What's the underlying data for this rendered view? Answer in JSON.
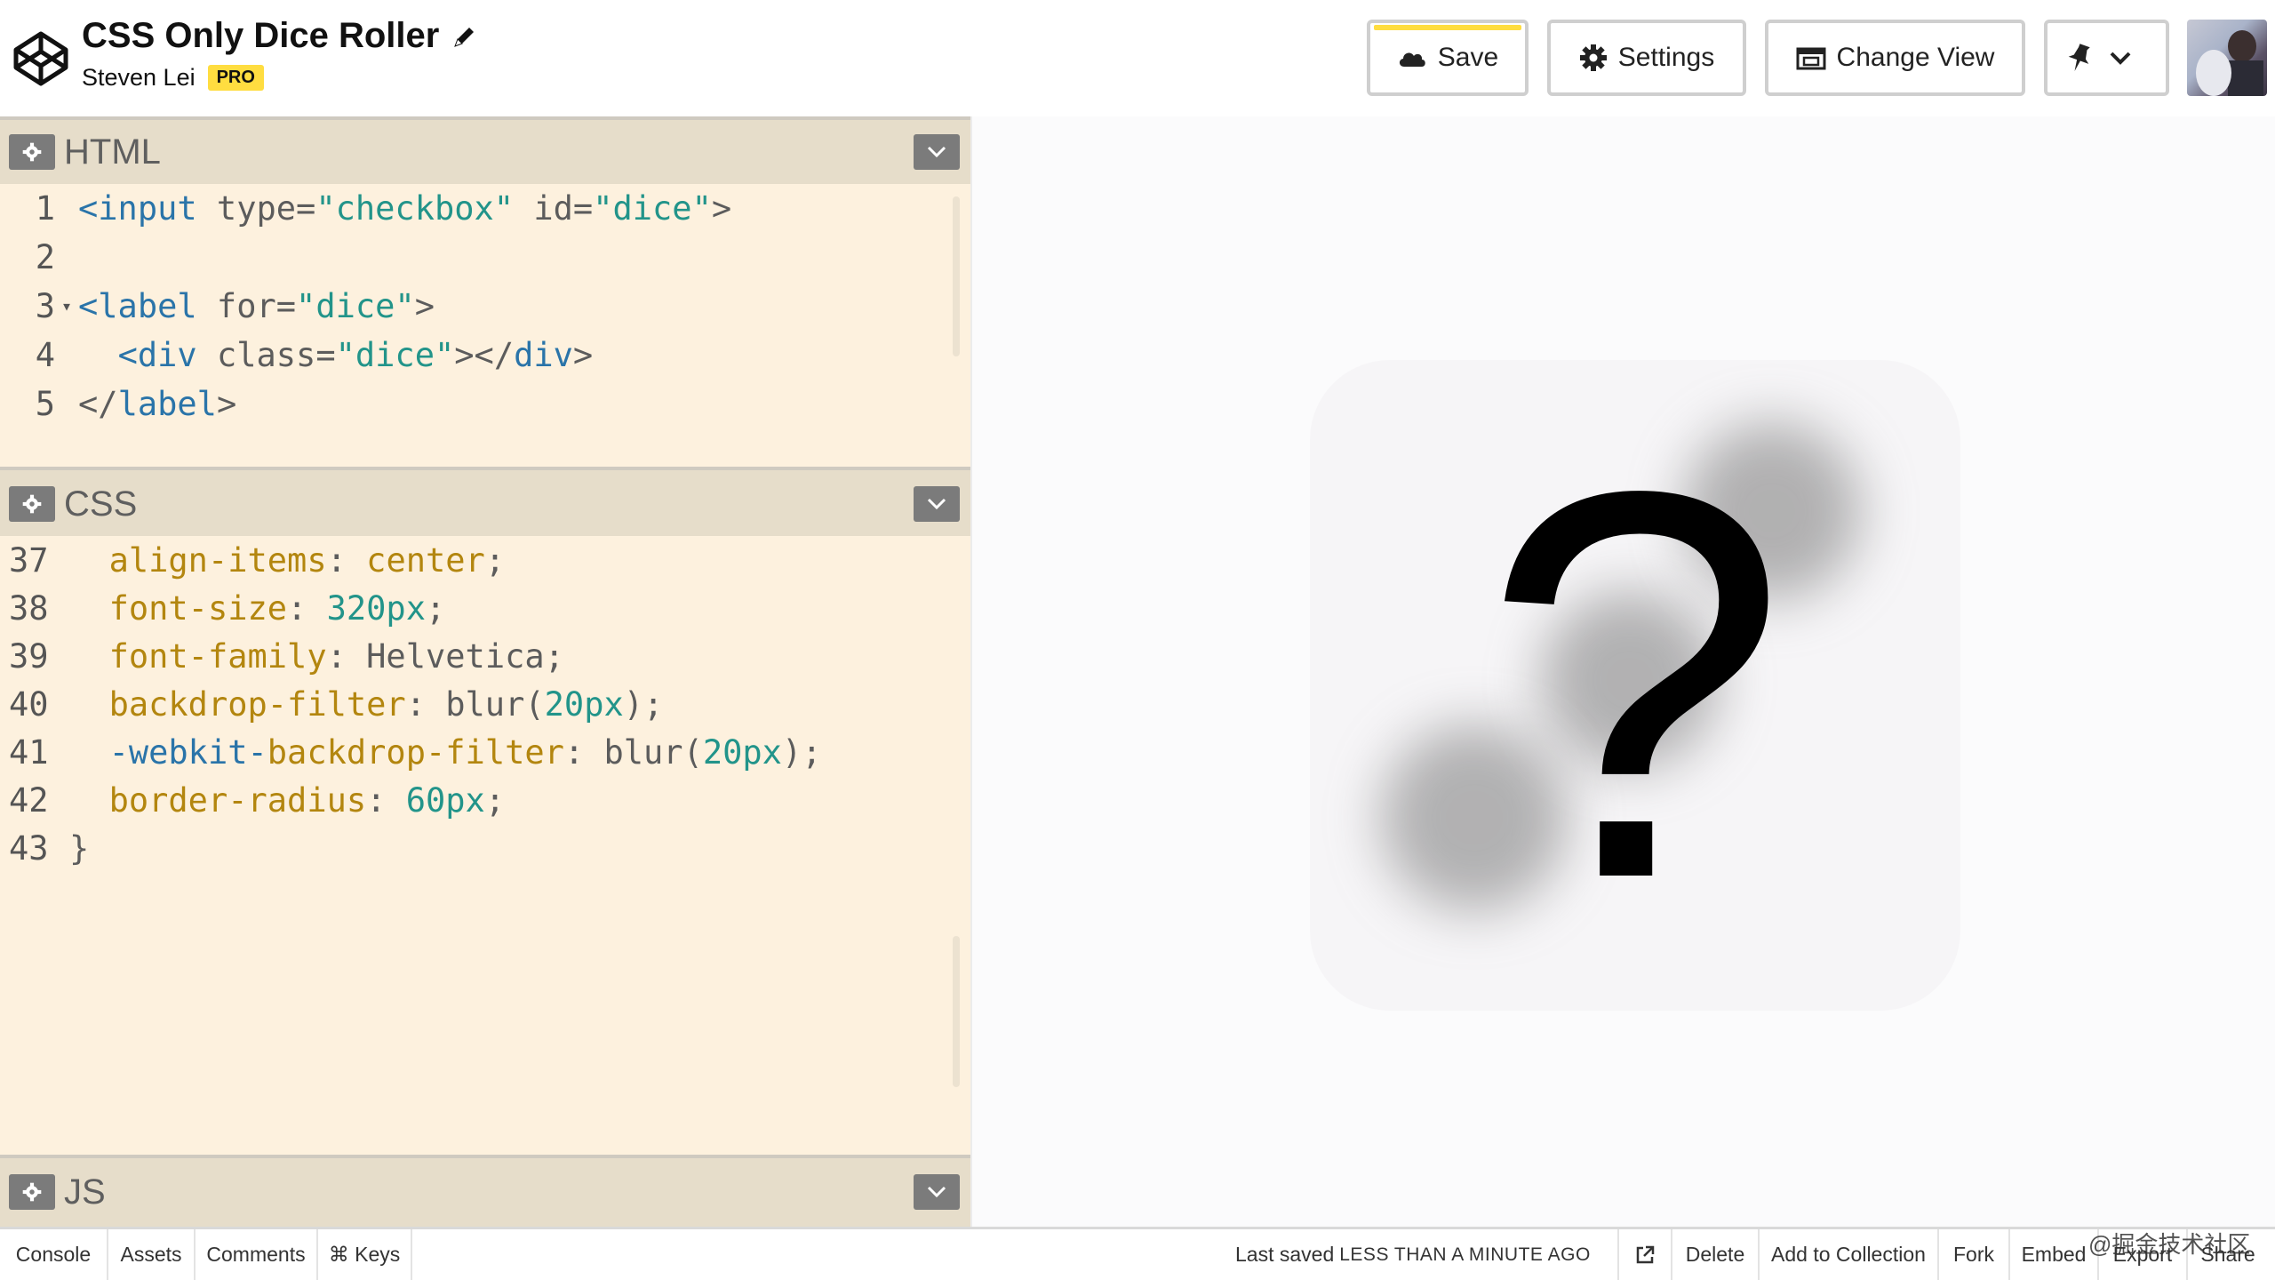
{
  "header": {
    "title": "CSS Only Dice Roller",
    "author": "Steven Lei",
    "badge": "PRO",
    "buttons": {
      "save": "Save",
      "settings": "Settings",
      "change_view": "Change View"
    }
  },
  "panes": {
    "html": {
      "title": "HTML",
      "lines": [
        {
          "num": "1",
          "fold": "",
          "indent": "",
          "parts": [
            [
              "tag",
              "<input"
            ],
            [
              "content",
              " type="
            ],
            [
              "str",
              "\"checkbox\""
            ],
            [
              "content",
              " id="
            ],
            [
              "str",
              "\"dice\""
            ],
            [
              "content",
              ">"
            ]
          ]
        },
        {
          "num": "2",
          "fold": "",
          "indent": "",
          "parts": []
        },
        {
          "num": "3",
          "fold": "▾",
          "indent": "",
          "parts": [
            [
              "tag",
              "<label"
            ],
            [
              "content",
              " for="
            ],
            [
              "str",
              "\"dice\""
            ],
            [
              "content",
              ">"
            ]
          ]
        },
        {
          "num": "4",
          "fold": "",
          "indent": "  ",
          "parts": [
            [
              "tag",
              "<div"
            ],
            [
              "content",
              " class="
            ],
            [
              "str",
              "\"dice\""
            ],
            [
              "content",
              "></"
            ],
            [
              "tag",
              "div"
            ],
            [
              "content",
              ">"
            ]
          ]
        },
        {
          "num": "5",
          "fold": "",
          "indent": "",
          "parts": [
            [
              "content",
              "</"
            ],
            [
              "tag",
              "label"
            ],
            [
              "content",
              ">"
            ]
          ]
        }
      ]
    },
    "css": {
      "title": "CSS",
      "lines": [
        {
          "num": "37",
          "indent": "  ",
          "parts": [
            [
              "prop",
              "align-items"
            ],
            [
              "content",
              ": "
            ],
            [
              "prop",
              "center"
            ],
            [
              "content",
              ";"
            ]
          ]
        },
        {
          "num": "38",
          "indent": "  ",
          "parts": [
            [
              "prop",
              "font-size"
            ],
            [
              "content",
              ": "
            ],
            [
              "num",
              "320px"
            ],
            [
              "content",
              ";"
            ]
          ]
        },
        {
          "num": "39",
          "indent": "  ",
          "parts": [
            [
              "prop",
              "font-family"
            ],
            [
              "content",
              ": Helvetica;"
            ]
          ]
        },
        {
          "num": "40",
          "indent": "  ",
          "parts": [
            [
              "prop",
              "backdrop-filter"
            ],
            [
              "content",
              ": blur("
            ],
            [
              "num",
              "20px"
            ],
            [
              "content",
              ");"
            ]
          ]
        },
        {
          "num": "41",
          "indent": "  ",
          "parts": [
            [
              "kw",
              "-webkit-"
            ],
            [
              "prop",
              "backdrop-filter"
            ],
            [
              "content",
              ": blur("
            ],
            [
              "num",
              "20px"
            ],
            [
              "content",
              ");"
            ]
          ]
        },
        {
          "num": "42",
          "indent": "  ",
          "parts": [
            [
              "prop",
              "border-radius"
            ],
            [
              "content",
              ": "
            ],
            [
              "num",
              "60px"
            ],
            [
              "content",
              ";"
            ]
          ]
        },
        {
          "num": "43",
          "indent": "",
          "parts": [
            [
              "content",
              "}"
            ]
          ]
        }
      ]
    },
    "js": {
      "title": "JS"
    }
  },
  "preview": {
    "symbol": "?"
  },
  "footer": {
    "console": "Console",
    "assets": "Assets",
    "comments": "Comments",
    "keys": "⌘ Keys",
    "last_saved_prefix": "Last saved",
    "last_saved_time": "LESS THAN A MINUTE AGO",
    "delete": "Delete",
    "add_to_collection": "Add to Collection",
    "fork": "Fork",
    "embed": "Embed",
    "export": "Export",
    "share": "Share"
  },
  "watermark": "@掘金技术社区",
  "colors": {
    "accent_yellow": "#ffdd40",
    "editor_bg": "#fdf1de",
    "pane_header": "#e6ddca",
    "tag": "#2a74a9",
    "string": "#22948a",
    "property": "#b3860f"
  }
}
